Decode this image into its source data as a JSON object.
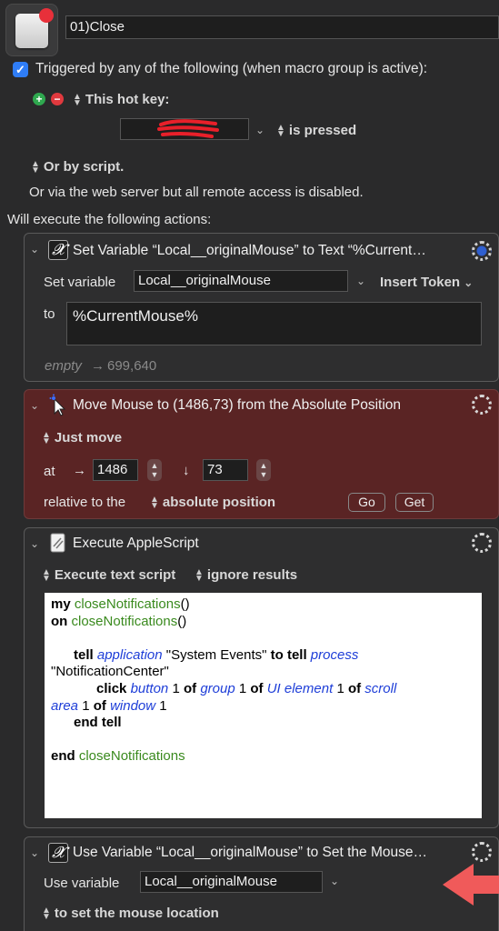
{
  "header": {
    "macro_name": "01)Close",
    "triggered_label": "Triggered by any of the following (when macro group is active):",
    "hotkey_label": "This hot key:",
    "is_pressed": "is pressed",
    "or_by_script": "Or by script.",
    "web_server_note": "Or via the web server but all remote access is disabled.",
    "will_execute": "Will execute the following actions:"
  },
  "actions": {
    "set_variable": {
      "title": "Set Variable “Local__originalMouse” to Text “%Current…",
      "set_variable_label": "Set variable",
      "variable_value": "Local__originalMouse",
      "insert_token": "Insert Token",
      "to_label": "to",
      "to_value": "%CurrentMouse%",
      "preview_empty": "empty",
      "preview_arrow": "→",
      "preview_value": "699,640"
    },
    "move_mouse": {
      "title": "Move Mouse to (1486,73) from the Absolute Position",
      "just_move": "Just move",
      "at_label": "at",
      "x_arrow": "→",
      "x_value": "1486",
      "y_arrow": "↓",
      "y_value": "73",
      "relative_label": "relative to the",
      "relative_value": "absolute position",
      "go_label": "Go",
      "get_label": "Get"
    },
    "applescript": {
      "title": "Execute AppleScript",
      "execute_mode": "Execute text script",
      "result_mode": "ignore results"
    },
    "use_variable": {
      "title": "Use Variable “Local__originalMouse” to Set the Mouse…",
      "use_variable_label": "Use variable",
      "variable_value": "Local__originalMouse",
      "set_location": "to set the mouse location"
    }
  },
  "script": {
    "l1_kw": "my",
    "l1_fn": "closeNotifications",
    "l1_rest": "()",
    "l2_kw": "on",
    "l2_fn": "closeNotifications",
    "l2_rest": "()",
    "l4_kw1": "tell",
    "l4_app": "application",
    "l4_str": "\"System Events\"",
    "l4_kw2": "to tell",
    "l4_proc": "process",
    "l5_str": "\"NotificationCenter\"",
    "l6_click": "click",
    "l6_button": "button",
    "l6_n1": "1",
    "l6_of1": "of",
    "l6_group": "group",
    "l6_n2": "1",
    "l6_of2": "of",
    "l6_uie": "UI element",
    "l6_n3": "1",
    "l6_of3": "of",
    "l6_scroll": "scroll",
    "l7_area": "area",
    "l7_n4": "1",
    "l7_of4": "of",
    "l7_window": "window",
    "l7_n5": "1",
    "l8_kw": "end tell",
    "l10_kw": "end",
    "l10_fn": "closeNotifications"
  },
  "colors": {
    "background": "#2a2a2b",
    "move_mouse_card": "#5a2424",
    "checkbox": "#2f7df6",
    "keyword_green": "#3a8a1e",
    "applescript_blue": "#1e3ed8",
    "annotation_arrow": "#f05a5a",
    "hotkey_redaction": "#e8202a"
  },
  "icons": [
    "macro-icon",
    "checkbox-icon",
    "plus-icon",
    "minus-icon",
    "updown-icon",
    "chevron-down-icon",
    "gear-icon",
    "variable-x-icon",
    "mouse-cursor-icon",
    "applescript-icon",
    "red-arrow-annotation"
  ]
}
